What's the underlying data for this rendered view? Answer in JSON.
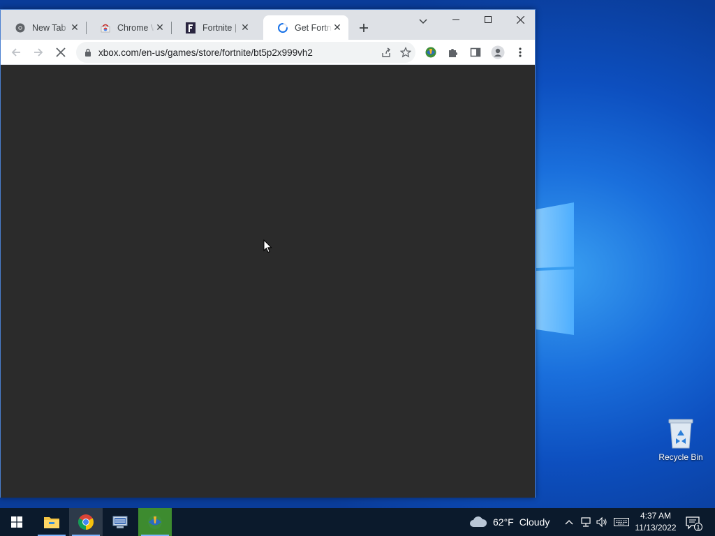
{
  "browser": {
    "tabs": [
      {
        "label": "New Tab",
        "favicon": "chrome-icon",
        "active": false
      },
      {
        "label": "Chrome Web Store",
        "favicon": "web-store-icon",
        "active": false
      },
      {
        "label": "Fortnite | Free-to-Play",
        "favicon": "fortnite-icon",
        "active": false
      },
      {
        "label": "Get Fortnite",
        "favicon": "loading-spinner-icon",
        "active": true
      }
    ],
    "url": "xbox.com/en-us/games/store/fortnite/bt5p2x999vh2",
    "page_state": "loading"
  },
  "desktop": {
    "recycle_bin_label": "Recycle Bin"
  },
  "taskbar": {
    "weather_temp": "62°F",
    "weather_condition": "Cloudy",
    "time": "4:37 AM",
    "date": "11/13/2022",
    "notification_count": "1"
  },
  "colors": {
    "page_background": "#2b2b2b",
    "tabstrip": "#dee1e6",
    "taskbar": "#0b1a2c"
  }
}
